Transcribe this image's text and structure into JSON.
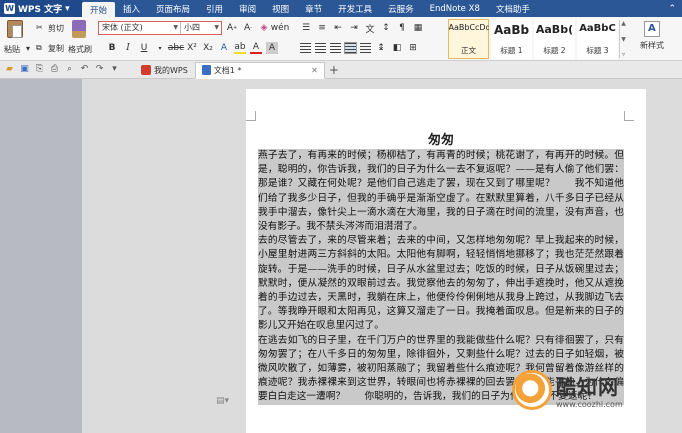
{
  "menubar": {
    "app_name": "WPS 文字",
    "tabs": [
      "开始",
      "插入",
      "页面布局",
      "引用",
      "审阅",
      "视图",
      "章节",
      "开发工具",
      "云服务",
      "EndNote X8",
      "文档助手"
    ],
    "active_tab": "开始"
  },
  "ribbon": {
    "paste_label": "粘贴",
    "cut_label": "剪切",
    "copy_label": "复制",
    "format_painter_label": "格式刷",
    "font_name": "宋体 (正文)",
    "font_size": "小四",
    "styles": [
      {
        "sample": "AaBbCcDd",
        "label": "正文"
      },
      {
        "sample": "AaBb",
        "label": "标题 1"
      },
      {
        "sample": "AaBb(",
        "label": "标题 2"
      },
      {
        "sample": "AaBbC",
        "label": "标题 3"
      }
    ],
    "new_style_label": "新样式"
  },
  "tabbar": {
    "tabs": [
      {
        "label": "我的WPS"
      },
      {
        "label": "文档1 *"
      }
    ]
  },
  "document": {
    "title": "匆匆",
    "paragraphs": [
      "燕子去了，有再来的时候；杨柳枯了，有再青的时候；桃花谢了，有再开的时候。但是，聪明的，你告诉我，我们的日子为什么一去不复返呢？——是有人偷了他们罢：那是谁？又藏在何处呢？是他们自己逃走了罢，现在又到了哪里呢？　　我不知道他们给了我多少日子，但我的手确乎是渐渐空虚了。在默默里算着，八千多日子已经从我手中溜去，像针尖上一滴水滴在大海里，我的日子滴在时间的流里，没有声音，也没有影子。我不禁头涔涔而泪潸潸了。",
      "去的尽管去了，来的尽管来着；去来的中间，又怎样地匆匆呢？早上我起来的时候，小屋里射进两三方斜斜的太阳。太阳他有脚啊，轻轻悄悄地挪移了；我也茫茫然跟着旋转。于是——洗手的时候，日子从水盆里过去；吃饭的时候，日子从饭碗里过去；默默时，便从凝然的双眼前过去。我觉察他去的匆匆了，伸出手遮挽时，他又从遮挽着的手边过去，天黑时，我躺在床上，他便伶伶俐俐地从我身上跨过，从我脚边飞去了。等我睁开眼和太阳再见，这算又溜走了一日。我掩着面叹息。但是新来的日子的影儿又开始在叹息里闪过了。",
      "在逃去如飞的日子里，在千门万户的世界里的我能做些什么呢？只有徘徊罢了，只有匆匆罢了；在八千多日的匆匆里，除徘徊外，又剩些什么呢？过去的日子如轻烟，被微风吹散了，如薄雾，被初阳蒸融了；我留着些什么痕迹呢？我何曾留着像游丝样的痕迹呢？我赤裸裸来到这世界，转眼间也将赤裸裸的回去罢？但不能平的，为什么偏要白白走这一遭啊？　　你聪明的，告诉我，我们的日子为什么一去不复返呢？"
    ]
  },
  "watermark": {
    "name": "酷知网",
    "url": "www.coozhi.com"
  }
}
